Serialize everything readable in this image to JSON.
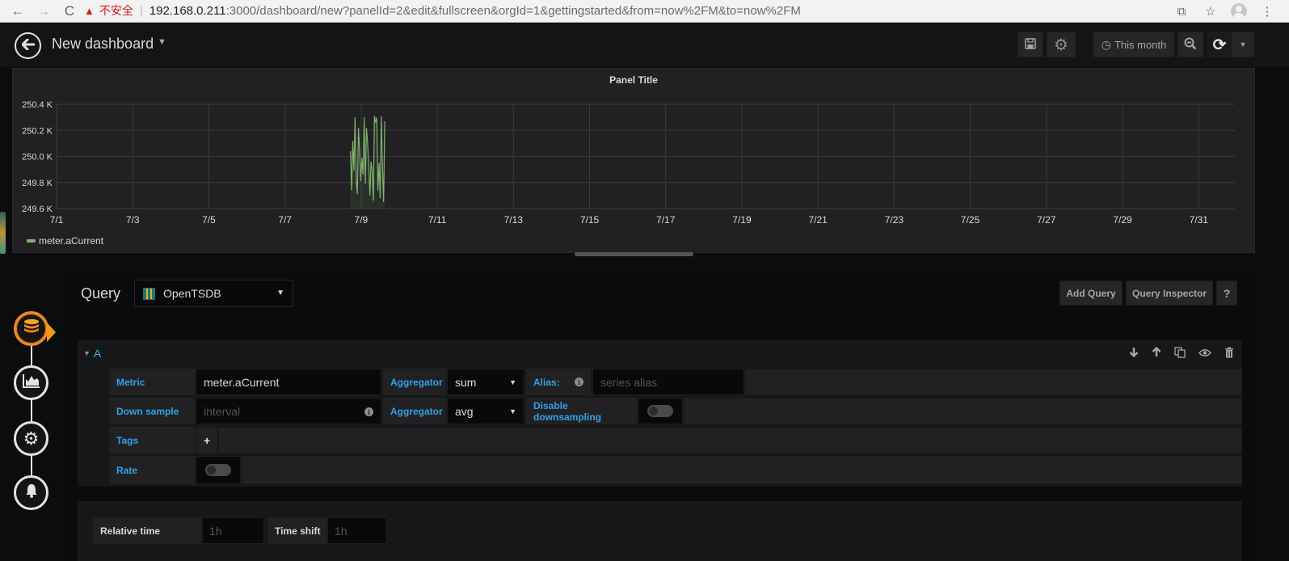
{
  "browser": {
    "back_icon": "←",
    "forward_icon": "→",
    "reload_icon": "C",
    "security_icon": "▲",
    "security_text": "不安全",
    "url_host": "192.168.0.211",
    "url_rest": ":3000/dashboard/new?panelId=2&edit&fullscreen&orgId=1&gettingstarted&from=now%2FM&to=now%2FM",
    "translate_icon": "⧉",
    "star_icon": "☆",
    "menu_icon": "⋮"
  },
  "navbar": {
    "back_icon": "🡐",
    "title": "New dashboard",
    "title_caret": "▼",
    "save_icon": "🖫",
    "settings_icon": "⚙",
    "time_picker_icon": "◷",
    "time_picker_label": "This month",
    "zoom_out_icon": "⊖",
    "refresh_icon": "⟳",
    "refresh_caret": "▼"
  },
  "panel": {
    "title": "Panel Title",
    "legend": [
      {
        "name": "meter.aCurrent",
        "color": "#7eb26d"
      }
    ]
  },
  "chart_data": {
    "type": "line",
    "title": "Panel Title",
    "xlabel": "",
    "ylabel": "",
    "x_unit": "day of July",
    "xlim": [
      1,
      32
    ],
    "ylim": [
      249.6,
      250.4
    ],
    "y_unit": "K",
    "y_ticks": [
      "249.6 K",
      "249.8 K",
      "250.0 K",
      "250.2 K",
      "250.4 K"
    ],
    "y_tick_values": [
      249.6,
      249.8,
      250.0,
      250.2,
      250.4
    ],
    "x_ticks": [
      "7/1",
      "7/3",
      "7/5",
      "7/7",
      "7/9",
      "7/11",
      "7/13",
      "7/15",
      "7/17",
      "7/19",
      "7/21",
      "7/23",
      "7/25",
      "7/27",
      "7/29",
      "7/31"
    ],
    "x_tick_values": [
      1,
      3,
      5,
      7,
      9,
      11,
      13,
      15,
      17,
      19,
      21,
      23,
      25,
      27,
      29,
      31
    ],
    "grid": true,
    "legend_position": "bottom-left",
    "fill": true,
    "series": [
      {
        "name": "meter.aCurrent",
        "color": "#7eb26d",
        "x": [
          8.72,
          8.75,
          8.78,
          8.81,
          8.84,
          8.87,
          8.9,
          8.93,
          8.96,
          8.99,
          9.02,
          9.05,
          9.08,
          9.11,
          9.14,
          9.17,
          9.2,
          9.23,
          9.26,
          9.29,
          9.32,
          9.35,
          9.38,
          9.41,
          9.44,
          9.47,
          9.5,
          9.53,
          9.56,
          9.59,
          9.62
        ],
        "y": [
          250.04,
          249.74,
          250.12,
          249.89,
          250.3,
          249.83,
          249.71,
          250.22,
          250.04,
          249.81,
          249.99,
          249.86,
          250.3,
          249.79,
          250.22,
          250.1,
          249.93,
          249.7,
          249.96,
          249.89,
          249.66,
          250.31,
          250.26,
          250.3,
          249.74,
          249.95,
          249.68,
          250.31,
          249.92,
          249.65,
          250.27
        ]
      }
    ]
  },
  "editor": {
    "query_label": "Query",
    "datasource": "OpenTSDB",
    "datasource_caret": "▼",
    "add_query_label": "Add Query",
    "query_inspector_label": "Query Inspector",
    "help_label": "?",
    "steps": [
      {
        "name": "queries",
        "icon": "database-icon",
        "active": true
      },
      {
        "name": "visualization",
        "icon": "chart-icon",
        "active": false
      },
      {
        "name": "general",
        "icon": "gear-wrench-icon",
        "active": false
      },
      {
        "name": "alert",
        "icon": "bell-icon",
        "active": false
      }
    ],
    "query_row": {
      "ref_id": "A",
      "caret": "▼",
      "actions": {
        "move_down": "🡣",
        "move_up": "🡡",
        "duplicate": "⧉",
        "toggle": "◉",
        "remove": "🗑"
      }
    },
    "fields": {
      "metric_label": "Metric",
      "metric_value": "meter.aCurrent",
      "aggregator_label": "Aggregator",
      "aggregator_value": "sum",
      "alias_label": "Alias:",
      "alias_placeholder": "series alias",
      "downsample_label": "Down sample",
      "downsample_placeholder": "interval",
      "ds_aggregator_label": "Aggregator",
      "ds_aggregator_value": "avg",
      "disable_downsampling_label": "Disable downsampling",
      "disable_downsampling": false,
      "tags_label": "Tags",
      "add_tag": "+",
      "rate_label": "Rate",
      "rate": false,
      "info_glyph": "i",
      "select_caret": "▼"
    },
    "time_options": {
      "relative_time_label": "Relative time",
      "relative_time_placeholder": "1h",
      "time_shift_label": "Time shift",
      "time_shift_placeholder": "1h"
    }
  }
}
